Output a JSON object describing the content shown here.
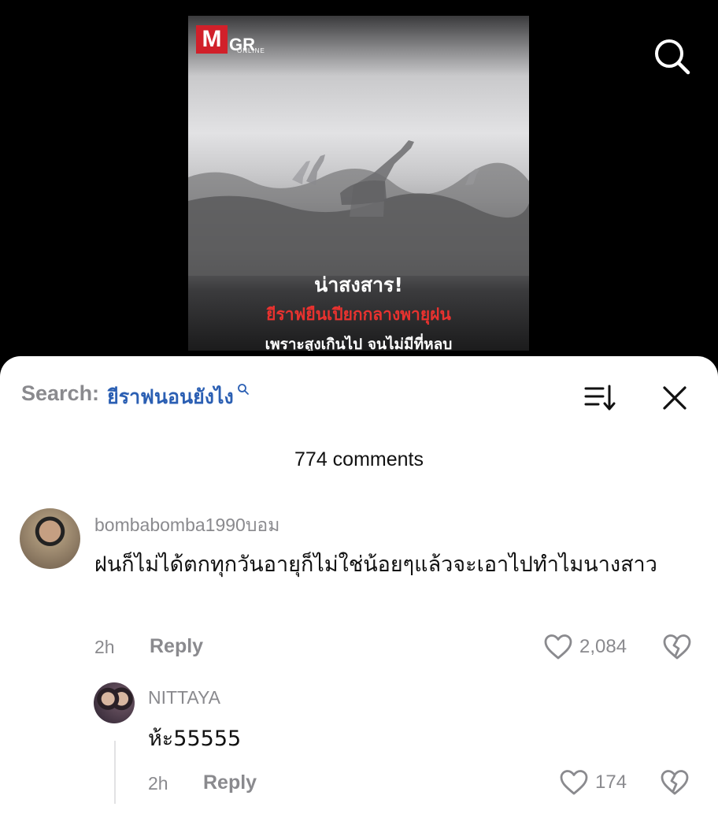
{
  "video": {
    "logo_main": "M",
    "logo_gr": "GR",
    "logo_sub": "ONLINE",
    "caption_line1": "น่าสงสาร!",
    "caption_line2": "ยีราฟยืนเปียกกลางพายุฝน",
    "caption_line3": "เพราะสูงเกินไป จนไม่มีที่หลบ",
    "icons": {
      "search": "search-icon"
    }
  },
  "comments_sheet": {
    "search_label": "Search:",
    "search_query": "ยีราฟนอนยังไง",
    "count_text": "774 comments",
    "icons": {
      "sort": "sort-icon",
      "close": "close-icon"
    },
    "comments": [
      {
        "username": "bombabomba1990บอม",
        "text": "ฝนก็ไม่ได้ตกทุกวันอายุก็ไม่ใช่น้อยๆแล้วจะเอาไปทำไมนางสาว",
        "time": "2h",
        "reply_label": "Reply",
        "likes": "2,084"
      },
      {
        "username": "NITTAYA",
        "text": "ห้ะ55555",
        "time": "2h",
        "reply_label": "Reply",
        "likes": "174"
      }
    ]
  },
  "colors": {
    "accent_blue": "#2b5fb3",
    "caption_red": "#e8322f",
    "muted_gray": "#8a8a8e"
  }
}
